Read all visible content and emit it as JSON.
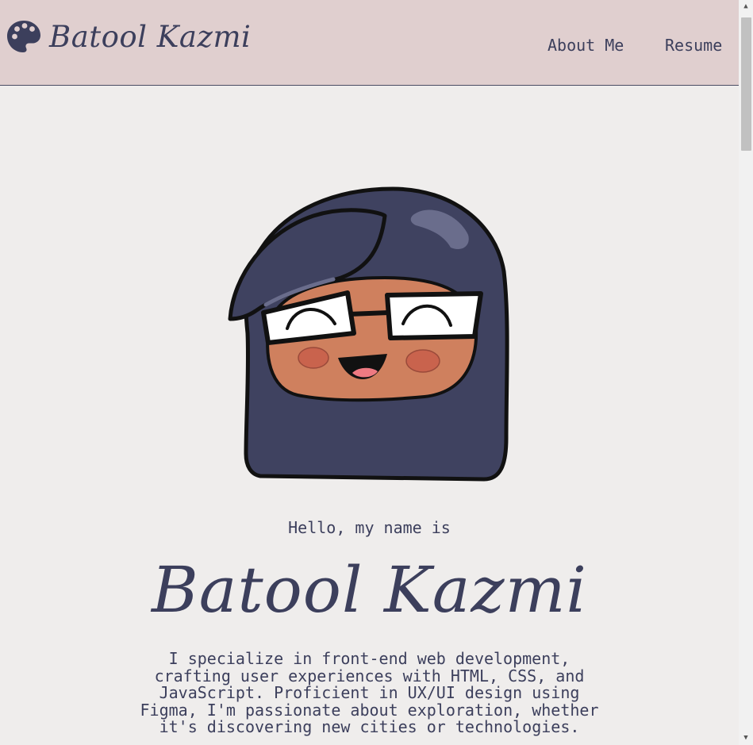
{
  "nav": {
    "brand_name": "Batool Kazmi",
    "brand_icon": "palette-icon",
    "links": [
      {
        "label": "About Me"
      },
      {
        "label": "Resume"
      }
    ]
  },
  "hero": {
    "avatar": "cartoon-avatar",
    "greeting": "Hello, my name is",
    "name": "Batool Kazmi",
    "bio": "I specialize in front-end web development, crafting user experiences with HTML, CSS, and JavaScript. Proficient in UX/UI design using Figma, I'm passionate about exploration, whether it's discovering new cities or technologies."
  },
  "colors": {
    "navbar_bg": "#e0cfcf",
    "page_bg": "#efedec",
    "text": "#3c3f5c",
    "hair": "#3f4260",
    "skin": "#cf805e",
    "cheeks": "#c9634d"
  }
}
